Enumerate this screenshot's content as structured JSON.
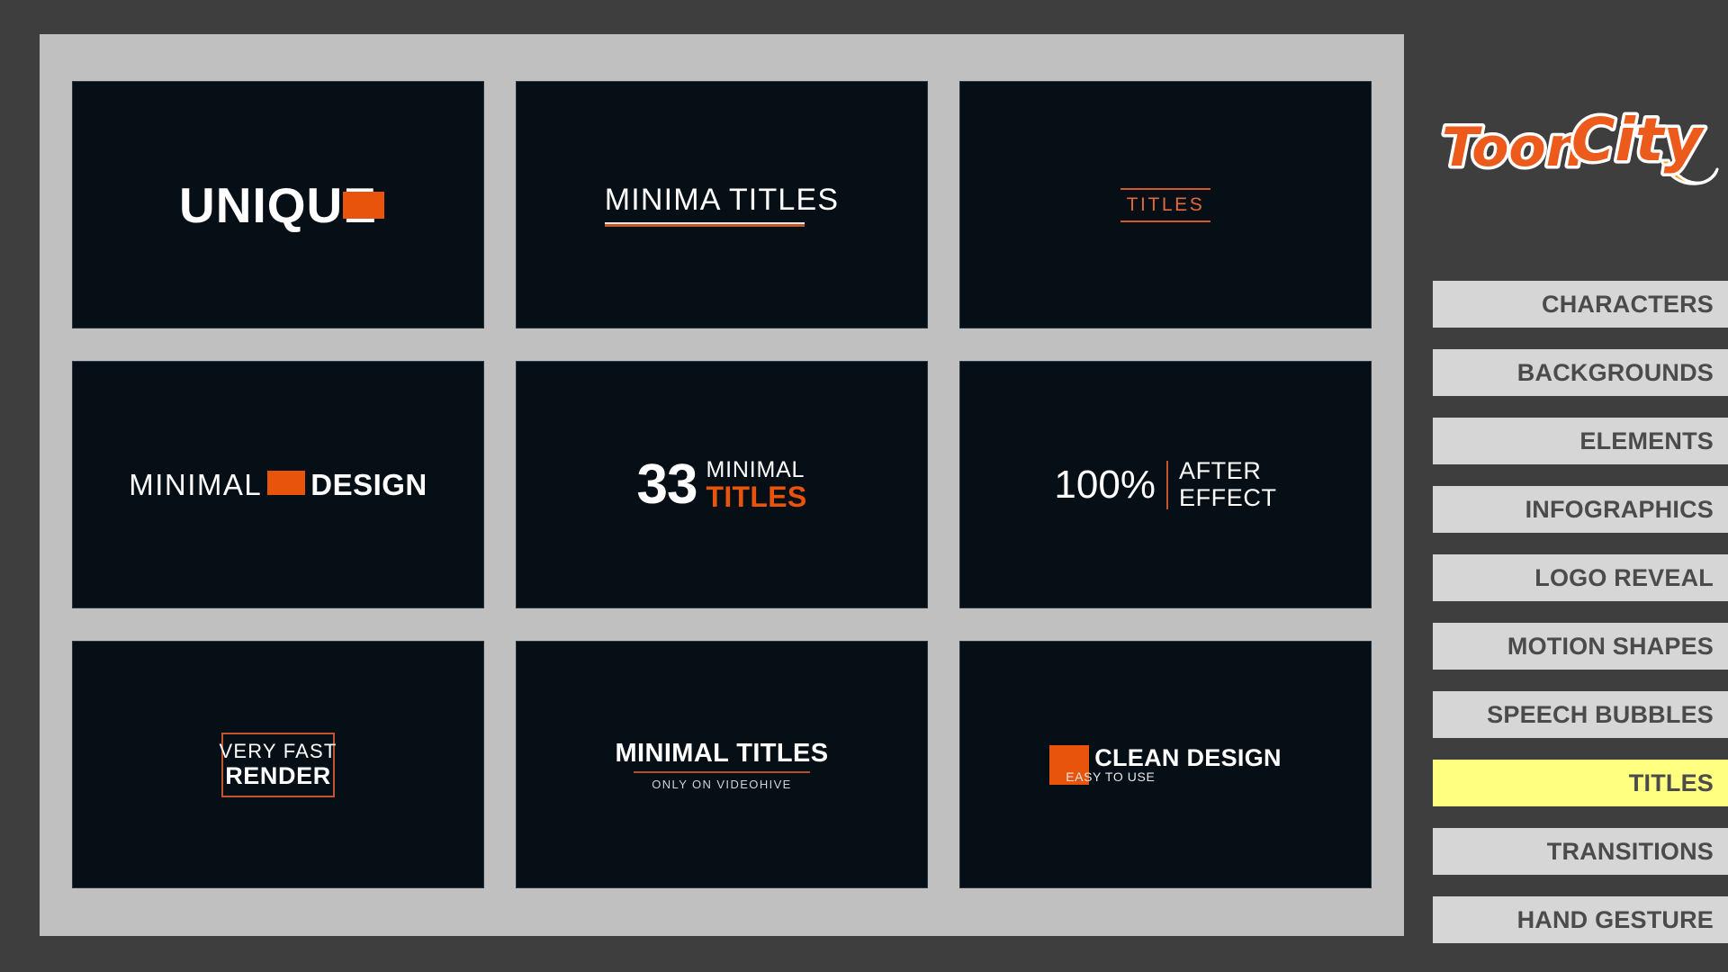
{
  "app": {
    "background_color": "#3e3e3e",
    "panel_color": "#c0c0c0",
    "thumb_color": "#060f16",
    "accent_color": "#e8540c",
    "highlight_color": "#ffff80",
    "menu_color": "#d6d6d6",
    "menu_text_color": "#4b4b4b"
  },
  "brand": {
    "name": "ToonCity",
    "part_one": "Toon",
    "part_two": "City",
    "logo_color": "#ec5b1c",
    "logo_outline_color": "#ffffff",
    "swoosh_color": "#f5a623"
  },
  "gallery": {
    "items": [
      {
        "id": "unique",
        "word": "UNIQUE",
        "style": "white-bold-with-orange-block"
      },
      {
        "id": "minima-titles",
        "word": "MINIMA TITLES",
        "style": "white-with-double-rule"
      },
      {
        "id": "titles",
        "word": "TITLES",
        "style": "orange-between-rules"
      },
      {
        "id": "minimal-design",
        "word_thin": "MINIMAL",
        "word_bold": "DESIGN",
        "style": "thin-block-bold"
      },
      {
        "id": "33-minimal-titles",
        "number": "33",
        "word_top": "MINIMAL",
        "word_bottom": "TITLES",
        "style": "number-stacked"
      },
      {
        "id": "100-after-effect",
        "number": "100%",
        "word_top": "AFTER",
        "word_bottom": "EFFECT",
        "style": "percent-divider-stacked"
      },
      {
        "id": "very-fast-render",
        "word_thin": "VERY FAST",
        "word_bold": "RENDER",
        "style": "outlined-box"
      },
      {
        "id": "minimal-titles-videohive",
        "title": "MINIMAL TITLES",
        "subtitle": "ONLY ON VIDEOHIVE",
        "style": "bold-rule-subtitle"
      },
      {
        "id": "clean-design",
        "title": "CLEAN DESIGN",
        "subtitle": "EASY TO USE",
        "style": "square-stacked"
      }
    ]
  },
  "menu": {
    "items": [
      {
        "label": "CHARACTERS",
        "active": false
      },
      {
        "label": "BACKGROUNDS",
        "active": false
      },
      {
        "label": "ELEMENTS",
        "active": false
      },
      {
        "label": "INFOGRAPHICS",
        "active": false
      },
      {
        "label": "LOGO REVEAL",
        "active": false
      },
      {
        "label": "MOTION SHAPES",
        "active": false
      },
      {
        "label": "SPEECH BUBBLES",
        "active": false
      },
      {
        "label": "TITLES",
        "active": true
      },
      {
        "label": "TRANSITIONS",
        "active": false
      },
      {
        "label": "HAND GESTURE",
        "active": false
      }
    ]
  }
}
